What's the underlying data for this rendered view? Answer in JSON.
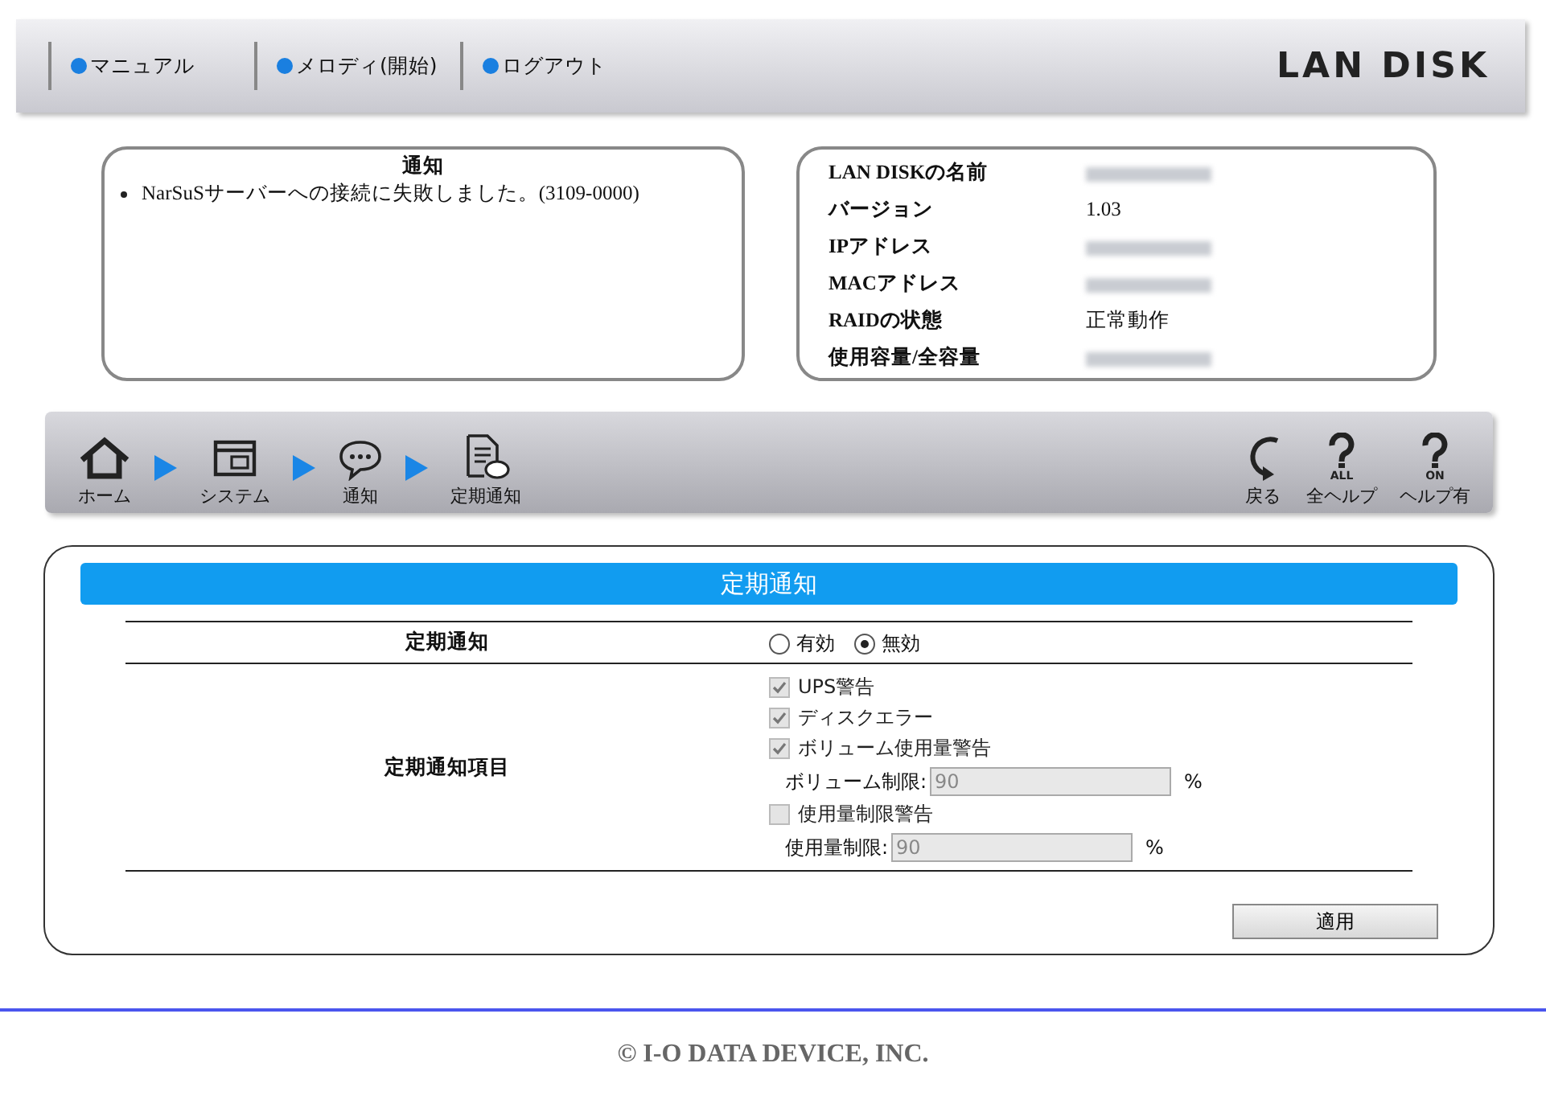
{
  "header": {
    "links": [
      {
        "label": "マニュアル"
      },
      {
        "label": "メロディ(開始)"
      },
      {
        "label": "ログアウト"
      }
    ],
    "logo": "LAN DISK"
  },
  "notice": {
    "title": "通知",
    "items": [
      "NarSuSサーバーへの接続に失敗しました。(3109-0000)"
    ]
  },
  "device_info": [
    {
      "label": "LAN DISKの名前",
      "kind": "hidden"
    },
    {
      "label": "バージョン",
      "kind": "text",
      "value": "1.03"
    },
    {
      "label": "IPアドレス",
      "kind": "hidden"
    },
    {
      "label": "MACアドレス",
      "kind": "hidden"
    },
    {
      "label": "RAIDの状態",
      "kind": "text",
      "value": "正常動作"
    },
    {
      "label": "使用容量/全容量",
      "kind": "hidden"
    }
  ],
  "breadcrumb": [
    {
      "label": "ホーム"
    },
    {
      "label": "システム"
    },
    {
      "label": "通知"
    },
    {
      "label": "定期通知"
    }
  ],
  "tools": [
    {
      "label": "戻る"
    },
    {
      "label": "全ヘルプ",
      "sub": "ALL"
    },
    {
      "label": "ヘルプ有",
      "sub": "ON"
    }
  ],
  "panel": {
    "title": "定期通知",
    "rows": [
      {
        "label": "定期通知",
        "kind": "radio",
        "options": [
          {
            "label": "有効",
            "selected": false
          },
          {
            "label": "無効",
            "selected": true
          }
        ]
      },
      {
        "label": "定期通知項目",
        "kind": "checks",
        "items": [
          {
            "label": "UPS警告",
            "checked": true,
            "disabled": true
          },
          {
            "label": "ディスクエラー",
            "checked": true,
            "disabled": true
          },
          {
            "label": "ボリューム使用量警告",
            "checked": true,
            "disabled": true,
            "field": {
              "label": "ボリューム制限:",
              "value": "90",
              "unit": "%",
              "disabled": true
            }
          },
          {
            "label": "使用量制限警告",
            "checked": false,
            "disabled": true,
            "field": {
              "label": "使用量制限:",
              "value": "90",
              "unit": "%",
              "disabled": true
            }
          }
        ]
      }
    ],
    "apply": "適用"
  },
  "footer": "© I-O DATA DEVICE, INC."
}
